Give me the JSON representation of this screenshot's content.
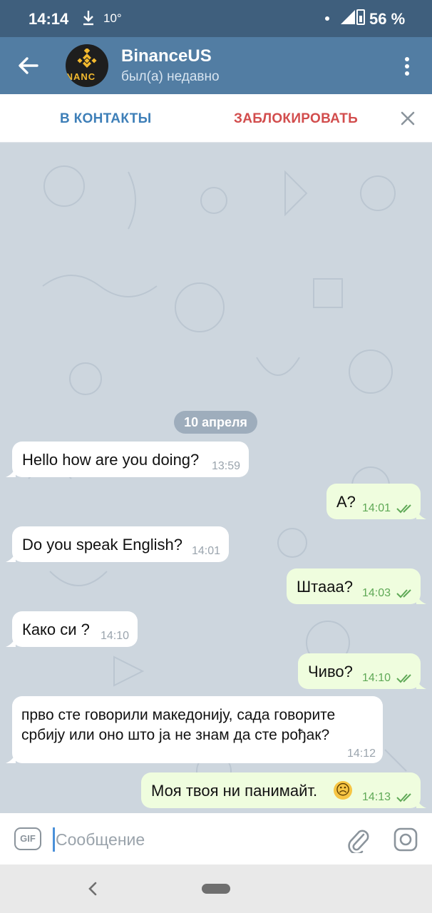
{
  "status_bar": {
    "time": "14:14",
    "temperature": "10°",
    "battery": "56 %",
    "icons": [
      "download-icon",
      "notification-dot-icon",
      "signal-icon",
      "battery-icon"
    ]
  },
  "header": {
    "contact_name": "BinanceUS",
    "contact_status": "был(а) недавно",
    "avatar_text": "INANC",
    "icons": [
      "back-arrow-icon",
      "more-vertical-icon"
    ]
  },
  "action_bar": {
    "add_contact": "В КОНТАКТЫ",
    "block": "ЗАБЛОКИРОВАТЬ",
    "colors": {
      "add": "#3e7fb8",
      "block": "#d24d4d"
    }
  },
  "chat": {
    "date_label": "10 апреля",
    "messages": [
      {
        "direction": "in",
        "text": "Hello how are you doing?",
        "time": "13:59"
      },
      {
        "direction": "out",
        "text": "А?",
        "time": "14:01",
        "read": true
      },
      {
        "direction": "in",
        "text": "Do you speak English?",
        "time": "14:01"
      },
      {
        "direction": "out",
        "text": "Штааа?",
        "time": "14:03",
        "read": true
      },
      {
        "direction": "in",
        "text": "Како си ?",
        "time": "14:10"
      },
      {
        "direction": "out",
        "text": "Чиво?",
        "time": "14:10",
        "read": true
      },
      {
        "direction": "in",
        "text_lines": [
          "прво сте говорили македонију, сада говорите",
          "србију или оно што ја не знам да сте рођак?"
        ],
        "time": "14:12"
      },
      {
        "direction": "out",
        "text": "Моя твоя ни панимайт.",
        "emoji": "☹",
        "time": "14:13",
        "read": true
      }
    ]
  },
  "composer": {
    "gif_label": "GIF",
    "placeholder": "Сообщение",
    "icons": [
      "attach-icon",
      "camera-icon"
    ]
  },
  "colors": {
    "header_bg": "#527da3",
    "status_bg": "#3f5f7d",
    "incoming_bubble": "#ffffff",
    "outgoing_bubble": "#effdde",
    "read_check": "#5fa956"
  }
}
